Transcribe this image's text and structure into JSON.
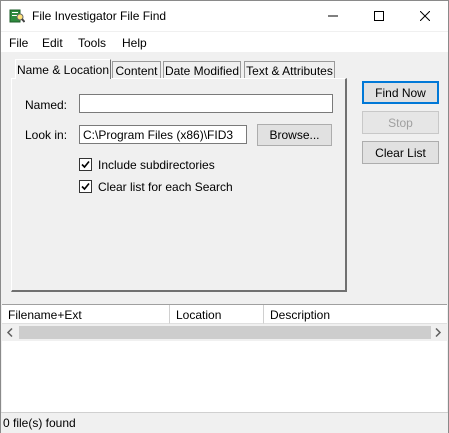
{
  "window": {
    "title": "File Investigator File Find",
    "icon": "magnifier-document-icon",
    "controls": {
      "minimize": "minimize-icon",
      "maximize": "maximize-icon",
      "close": "close-icon"
    }
  },
  "menu": [
    "File",
    "Edit",
    "Tools",
    "Help"
  ],
  "tabs": [
    "Name & Location",
    "Content",
    "Date Modified",
    "Text & Attributes"
  ],
  "active_tab": "Name & Location",
  "form": {
    "named_label": "Named:",
    "named_value": "",
    "lookin_label": "Look in:",
    "lookin_value": "C:\\Program Files (x86)\\FID3",
    "browse_label": "Browse...",
    "include_subdirs_label": "Include subdirectories",
    "include_subdirs_checked": true,
    "clear_list_label": "Clear list for each Search",
    "clear_list_checked": true
  },
  "buttons": {
    "find_now": "Find Now",
    "stop": "Stop",
    "clear_list": "Clear List"
  },
  "results": {
    "columns": [
      "Filename+Ext",
      "Location",
      "Description"
    ],
    "rows": []
  },
  "status": "0 file(s) found",
  "colors": {
    "focus_border": "#0078d7",
    "window_bg": "#f0f0f0"
  }
}
